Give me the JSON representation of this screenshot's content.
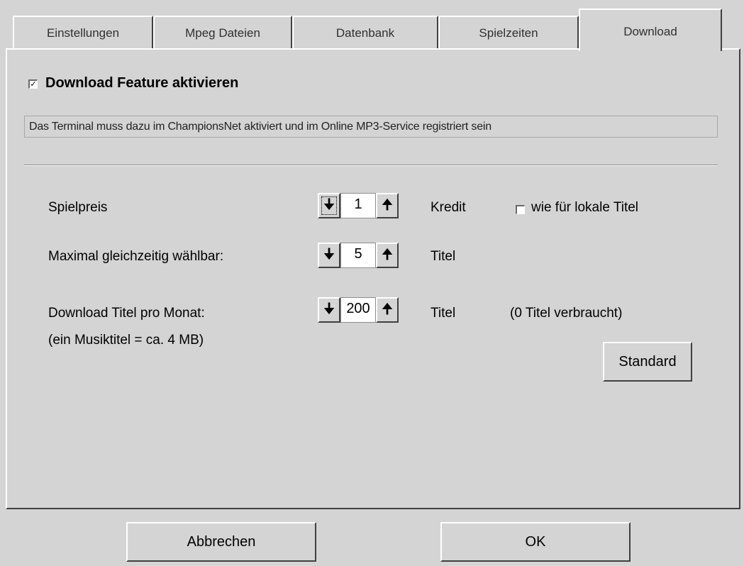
{
  "tabs": [
    "Einstellungen",
    "Mpeg Dateien",
    "Datenbank",
    "Spielzeiten",
    "Download"
  ],
  "download_feature": {
    "label": "Download Feature aktivieren",
    "checked": true
  },
  "info_text": "Das Terminal muss dazu im ChampionsNet aktiviert und im Online MP3-Service registriert sein",
  "rows": {
    "spielpreis": {
      "label": "Spielpreis",
      "value": "1",
      "unit": "Kredit",
      "checkbox_label": "wie für lokale Titel",
      "checkbox_checked": false
    },
    "maximal": {
      "label": "Maximal gleichzeitig wählbar:",
      "value": "5",
      "unit": "Titel"
    },
    "download_titel": {
      "label": "Download Titel pro Monat:",
      "value": "200",
      "unit": "Titel",
      "used_text": "(0 Titel verbraucht)",
      "note": "(ein Musiktitel = ca. 4 MB)"
    }
  },
  "icons": {
    "down": "arrow-down-icon",
    "up": "arrow-up-icon",
    "check": "checkmark-icon"
  },
  "buttons": {
    "standard": "Standard",
    "cancel": "Abbrechen",
    "ok": "OK"
  }
}
